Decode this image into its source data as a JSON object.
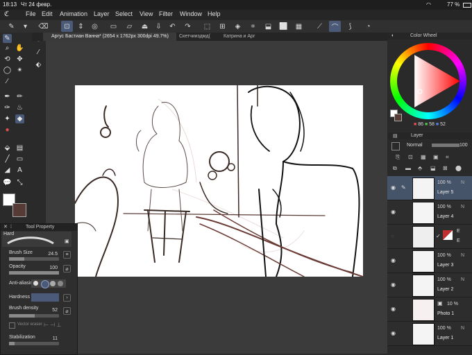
{
  "status": {
    "time": "18:13",
    "date": "Чт 24 февр.",
    "battery": "77 %"
  },
  "menu": [
    "File",
    "Edit",
    "Animation",
    "Layer",
    "Select",
    "View",
    "Filter",
    "Window",
    "Help"
  ],
  "tabs": [
    {
      "label": "Аргус Бастиан Ванна* (2654 x 1762px 300dpi 49.7%)",
      "active": true
    },
    {
      "label": "Скетчииздмд(",
      "active": false
    },
    {
      "label": "Катрина и Арг",
      "active": false
    }
  ],
  "color_wheel": {
    "title": "Color Wheel",
    "r": "86",
    "g": "58",
    "b": "52",
    "swatch_color": "#563a34"
  },
  "layer_panel": {
    "tab": "Layer",
    "blend_mode": "Normal",
    "opacity": "100",
    "layers": [
      {
        "pct": "100 %",
        "name": "Layer 5",
        "mode": "N",
        "selected": true
      },
      {
        "pct": "100 %",
        "name": "Layer 4",
        "mode": "N",
        "selected": false
      },
      {
        "pct": "E",
        "name": "E",
        "mode": "",
        "selected": false
      },
      {
        "pct": "100 %",
        "name": "Layer 3",
        "mode": "N",
        "selected": false
      },
      {
        "pct": "100 %",
        "name": "Layer 2",
        "mode": "N",
        "selected": false
      },
      {
        "pct": "10 %",
        "name": "Photo 1",
        "mode": "",
        "selected": false
      },
      {
        "pct": "100 %",
        "name": "Layer 1",
        "mode": "N",
        "selected": false
      }
    ]
  },
  "tool_property": {
    "title": "Tool Property",
    "brush_name": "Hard",
    "brush_size_label": "Brush Size",
    "brush_size": "24.5",
    "opacity_label": "Opacity",
    "opacity": "100",
    "antialiasing_label": "Anti-aliasing",
    "hardness_label": "Hardness",
    "density_label": "Brush density",
    "density": "52",
    "vector_eraser_label": "Vector eraser",
    "stabilization_label": "Stabilization",
    "stabilization": "11"
  },
  "colors": {
    "main": "#ffffff",
    "sub": "#563a34",
    "accent": "#4a5a78"
  }
}
